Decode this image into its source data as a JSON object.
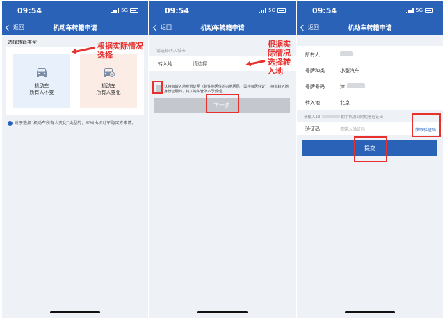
{
  "status": {
    "time": "09:54",
    "network": "5G"
  },
  "nav": {
    "back_label": "返回",
    "title": "机动车转籍申请"
  },
  "screen1": {
    "section_label": "选择转籍类型",
    "option_a": {
      "line1": "机动车",
      "line2": "所有人不变"
    },
    "option_b": {
      "line1": "机动车",
      "line2": "所有人变化"
    },
    "notice": "对于选择“机动车所有人变化”类型的，应当由机动车购买方申请。"
  },
  "screen2": {
    "hint": "请选择转入城市",
    "field_label": "转入地",
    "field_placeholder": "请选择",
    "checkbox_text": "认持有转入地身份证明（暂住地居住的内地居民，需持有居住证），持有转入地身份证明的，转入地车管所不予受理。",
    "next_button": "下一步"
  },
  "screen3": {
    "rows": [
      {
        "label": "所有人",
        "value": ""
      },
      {
        "label": "号牌种类",
        "value": "小型汽车"
      },
      {
        "label": "号牌号码",
        "value": "津"
      },
      {
        "label": "转入地",
        "value": "北京"
      }
    ],
    "sms_hint_prefix": "请输入13",
    "sms_hint_suffix": "的手机收到的短信验证码",
    "code_label": "验证码",
    "code_placeholder": "请输入验证码",
    "get_code_link": "获取验证码",
    "submit_button": "提交"
  },
  "annotations": {
    "note1": "根据实际情况选择",
    "note2": "根据实际情况选择转入地",
    "color": "#e6312e"
  }
}
